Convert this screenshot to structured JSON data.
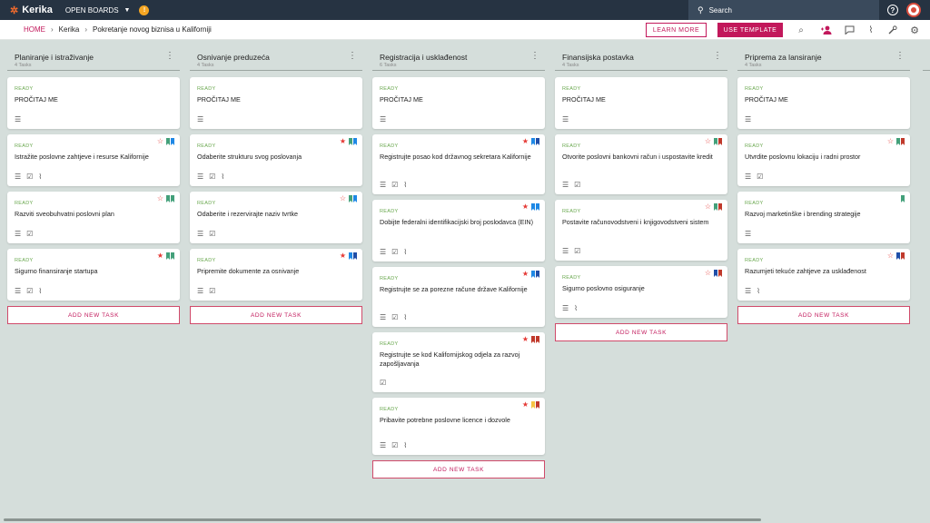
{
  "app": {
    "logo": "Kerika",
    "open_boards": "OPEN BOARDS",
    "org_badge": "!",
    "search_placeholder": "Search",
    "help": "?"
  },
  "breadcrumb": {
    "home": "HOME",
    "org": "Kerika",
    "board": "Pokretanje novog biznisa u Kaliforniji"
  },
  "toolbar": {
    "learn_more": "LEARN MORE",
    "use_template": "USE TEMPLATE"
  },
  "colors": {
    "accent": "#c2185b",
    "topbar": "#263342",
    "ready": "#6aa84f",
    "star": "#e53935",
    "green_tag": "#43a07a",
    "blue_tag": "#1e88e5",
    "red_tag": "#c0392b",
    "yellow_tag": "#f6c343",
    "dark_blue_tag": "#1f4ea8"
  },
  "add_task_label": "ADD NEW TASK",
  "columns": [
    {
      "title": "Planiranje i istraživanje",
      "count": "4 Tasks",
      "cards": [
        {
          "status": "READY",
          "title": "PROČITAJ ME",
          "star": "none",
          "tags": [],
          "icons": [
            "description-icon"
          ]
        },
        {
          "status": "READY",
          "title": "Istražite poslovne zahtjeve i resurse Kalifornije",
          "star": "empty",
          "tags": [
            "#43a07a",
            "#1e88e5"
          ],
          "icons": [
            "description-icon",
            "checklist-icon",
            "attachment-icon"
          ]
        },
        {
          "status": "READY",
          "title": "Razviti sveobuhvatni poslovni plan",
          "star": "empty",
          "tags": [
            "#43a07a",
            "#43a07a"
          ],
          "icons": [
            "description-icon",
            "checklist-icon"
          ]
        },
        {
          "status": "READY",
          "title": "Sigurno finansiranje startupa",
          "star": "filled",
          "tags": [
            "#43a07a",
            "#43a07a"
          ],
          "icons": [
            "description-icon",
            "checklist-icon",
            "attachment-icon"
          ]
        }
      ]
    },
    {
      "title": "Osnivanje preduzeća",
      "count": "4 Tasks",
      "cards": [
        {
          "status": "READY",
          "title": "PROČITAJ ME",
          "star": "none",
          "tags": [],
          "icons": [
            "description-icon"
          ]
        },
        {
          "status": "READY",
          "title": "Odaberite strukturu svog poslovanja",
          "star": "filled",
          "tags": [
            "#43a07a",
            "#1e88e5"
          ],
          "icons": [
            "description-icon",
            "checklist-icon",
            "attachment-icon"
          ]
        },
        {
          "status": "READY",
          "title": "Odaberite i rezervirajte naziv tvrtke",
          "star": "empty",
          "tags": [
            "#43a07a",
            "#1e88e5"
          ],
          "icons": [
            "description-icon",
            "checklist-icon"
          ]
        },
        {
          "status": "READY",
          "title": "Pripremite dokumente za osnivanje",
          "star": "filled",
          "tags": [
            "#1e88e5",
            "#1f4ea8"
          ],
          "icons": [
            "description-icon",
            "checklist-icon"
          ]
        }
      ]
    },
    {
      "title": "Registracija i usklađenost",
      "count": "6 Tasks",
      "cards": [
        {
          "status": "READY",
          "title": "PROČITAJ ME",
          "star": "none",
          "tags": [],
          "icons": [
            "description-icon"
          ]
        },
        {
          "status": "READY",
          "title": "Registrujte posao kod državnog sekretara Kalifornije",
          "star": "filled",
          "tags": [
            "#1e88e5",
            "#1f4ea8"
          ],
          "icons": [
            "description-icon",
            "checklist-icon",
            "attachment-icon"
          ]
        },
        {
          "status": "READY",
          "title": "Dobijte federalni identifikacijski broj poslodavca (EIN)",
          "star": "filled",
          "tags": [
            "#1e88e5",
            "#1e88e5"
          ],
          "icons": [
            "description-icon",
            "checklist-icon",
            "attachment-icon"
          ]
        },
        {
          "status": "READY",
          "title": "Registrujte se za porezne račune države Kalifornije",
          "star": "filled",
          "tags": [
            "#1e88e5",
            "#1f4ea8"
          ],
          "icons": [
            "description-icon",
            "checklist-icon",
            "attachment-icon"
          ]
        },
        {
          "status": "READY",
          "title": "Registrujte se kod Kalifornijskog odjela za razvoj zapošljavanja",
          "star": "filled",
          "tags": [
            "#c0392b",
            "#c0392b"
          ],
          "icons": [
            "checklist-icon"
          ]
        },
        {
          "status": "READY",
          "title": "Pribavite potrebne poslovne licence i dozvole",
          "star": "filled",
          "tags": [
            "#f6c343",
            "#c0392b"
          ],
          "icons": [
            "description-icon",
            "checklist-icon",
            "attachment-icon"
          ]
        }
      ]
    },
    {
      "title": "Finansijska postavka",
      "count": "4 Tasks",
      "cards": [
        {
          "status": "READY",
          "title": "PROČITAJ ME",
          "star": "none",
          "tags": [],
          "icons": [
            "description-icon"
          ]
        },
        {
          "status": "READY",
          "title": "Otvorite poslovni bankovni račun i uspostavite kredit",
          "star": "empty",
          "tags": [
            "#43a07a",
            "#c0392b"
          ],
          "icons": [
            "description-icon",
            "checklist-icon"
          ]
        },
        {
          "status": "READY",
          "title": "Postavite računovodstveni i knjigovodstveni sistem",
          "star": "empty",
          "tags": [
            "#43a07a",
            "#c0392b"
          ],
          "icons": [
            "description-icon",
            "checklist-icon"
          ]
        },
        {
          "status": "READY",
          "title": "Sigurno poslovno osiguranje",
          "star": "empty",
          "tags": [
            "#1f4ea8",
            "#c0392b"
          ],
          "icons": [
            "description-icon",
            "attachment-icon"
          ]
        }
      ]
    },
    {
      "title": "Priprema za lansiranje",
      "count": "4 Tasks",
      "cards": [
        {
          "status": "READY",
          "title": "PROČITAJ ME",
          "star": "none",
          "tags": [],
          "icons": [
            "description-icon"
          ]
        },
        {
          "status": "READY",
          "title": "Utvrdite poslovnu lokaciju i radni prostor",
          "star": "empty",
          "tags": [
            "#43a07a",
            "#c0392b"
          ],
          "icons": [
            "description-icon",
            "checklist-icon"
          ]
        },
        {
          "status": "READY",
          "title": "Razvoj marketinške i brending strategije",
          "star": "none",
          "tags": [
            "#43a07a"
          ],
          "icons": [
            "description-icon"
          ]
        },
        {
          "status": "READY",
          "title": "Razumjeti tekuće zahtjeve za usklađenost",
          "star": "empty",
          "tags": [
            "#1f4ea8",
            "#c0392b"
          ],
          "icons": [
            "description-icon",
            "attachment-icon"
          ]
        }
      ]
    }
  ]
}
